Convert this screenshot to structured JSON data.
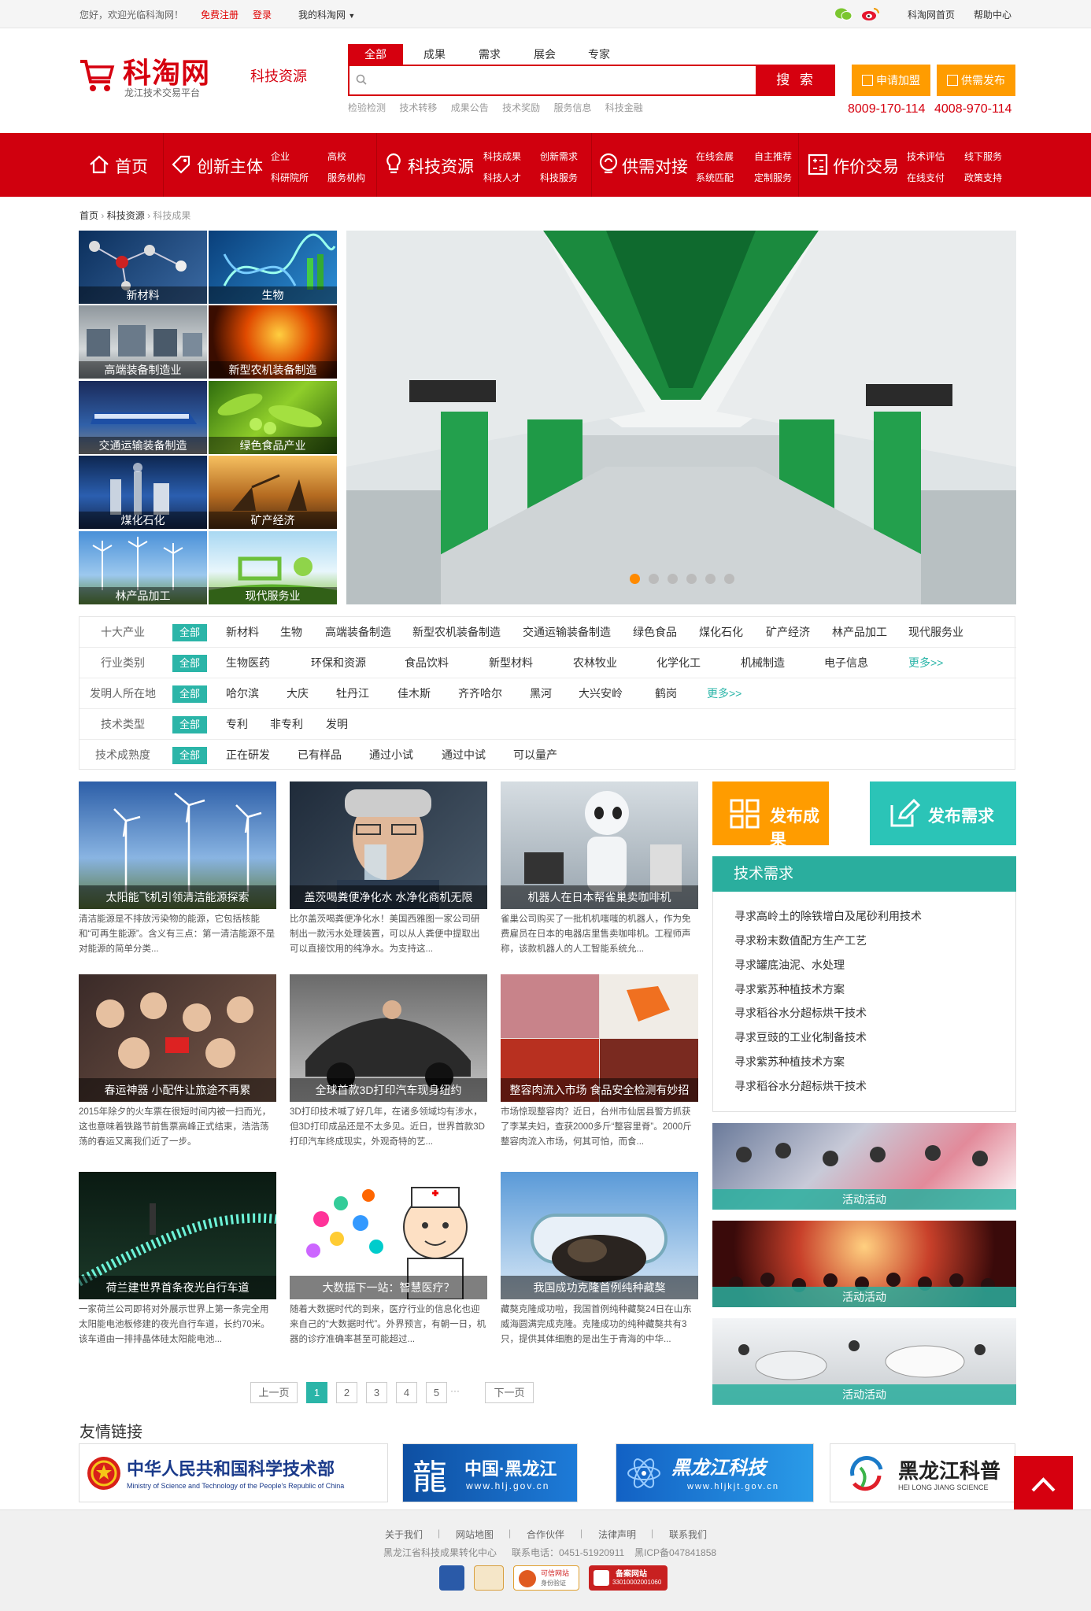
{
  "topbar": {
    "welcome": "您好，欢迎光临科淘网！",
    "register": "免费注册",
    "login": "登录",
    "my": "我的科淘网",
    "home": "科淘网首页",
    "help": "帮助中心"
  },
  "header": {
    "logo": "科淘网",
    "logo_sub": "龙江技术交易平台",
    "section": "科技资源",
    "search_tabs": [
      "全部",
      "成果",
      "需求",
      "展会",
      "专家"
    ],
    "search_button": "搜 索",
    "hot_words": [
      "检验检测",
      "技术转移",
      "成果公告",
      "技术奖励",
      "服务信息",
      "科技金融"
    ],
    "join_button": "申请加盟",
    "publish_button": "供需发布",
    "phone1": "8009-170-114",
    "phone2": "4008-970-114"
  },
  "nav": {
    "home": "首页",
    "main_body": "创新主体",
    "main_body_sub": [
      "企业",
      "高校",
      "科研院所",
      "服务机构"
    ],
    "resources": "科技资源",
    "resources_sub": [
      "科技成果",
      "创新需求",
      "科技人才",
      "科技服务"
    ],
    "supply": "供需对接",
    "supply_sub": [
      "在线会展",
      "自主推荐",
      "系统匹配",
      "定制服务"
    ],
    "trade": "作价交易",
    "trade_sub": [
      "技术评估",
      "线下服务",
      "在线支付",
      "政策支持"
    ]
  },
  "breadcrumb": [
    "首页",
    "科技资源",
    "科技成果"
  ],
  "categories": [
    "新材料",
    "生物",
    "高端装备制造业",
    "新型农机装备制造",
    "交通运输装备制造",
    "绿色食品产业",
    "煤化石化",
    "矿产经济",
    "林产品加工",
    "现代服务业"
  ],
  "banner": {
    "slide_count": 6,
    "active": 1
  },
  "filters": {
    "all": "全部",
    "more": "更多>>",
    "rows": [
      {
        "label": "十大产业",
        "items": [
          "新材料",
          "生物",
          "高端装备制造",
          "新型农机装备制造",
          "交通运输装备制造",
          "绿色食品",
          "煤化石化",
          "矿产经济",
          "林产品加工",
          "现代服务业"
        ]
      },
      {
        "label": "行业类别",
        "items": [
          "生物医药",
          "环保和资源",
          "食品饮料",
          "新型材料",
          "农林牧业",
          "化学化工",
          "机械制造",
          "电子信息"
        ]
      },
      {
        "label": "发明人所在地",
        "items": [
          "哈尔滨",
          "大庆",
          "牡丹江",
          "佳木斯",
          "齐齐哈尔",
          "黑河",
          "大兴安岭",
          "鹤岗"
        ]
      },
      {
        "label": "技术类型",
        "items": [
          "专利",
          "非专利",
          "发明"
        ]
      },
      {
        "label": "技术成熟度",
        "items": [
          "正在研发",
          "已有样品",
          "通过小试",
          "通过中试",
          "可以量产"
        ]
      }
    ]
  },
  "news": [
    {
      "title": "太阳能飞机引领清洁能源探索",
      "desc": "清洁能源是不排放污染物的能源，它包括核能和“可再生能源”。含义有三点：第一清洁能源不是对能源的简单分类..."
    },
    {
      "title": "盖茨喝粪便净化水 水净化商机无限",
      "desc": "比尔盖茨喝粪便净化水！美国西雅图一家公司研制出一款污水处理装置，可以从人粪便中提取出可以直接饮用的纯净水。为支持这..."
    },
    {
      "title": "机器人在日本帮雀巢卖咖啡机",
      "desc": "雀巢公司购买了一批机机嗤嗤的机器人，作为免费雇员在日本的电器店里售卖咖啡机。工程师声称，该款机器人的人工智能系统允..."
    },
    {
      "title": "春运神器 小配件让旅途不再累",
      "desc": "2015年除夕的火车票在很短时间内被一扫而光，这也意味着铁路节前售票高峰正式结束，浩浩荡荡的春运又离我们近了一步。"
    },
    {
      "title": "全球首款3D打印汽车现身纽约",
      "desc": "3D打印技术喊了好几年，在诸多领域均有涉水，但3D打印成品还是不太多见。近日，世界首款3D打印汽车终成现实，外观奇特的艺..."
    },
    {
      "title": "整容肉流入市场 食品安全检测有妙招",
      "desc": "市场惊现整容肉？近日，台州市仙居县警方抓获了李某夫妇，查获2000多斤“整容里脊”。2000斤整容肉流入市场，何其可怕，而食..."
    },
    {
      "title": "荷兰建世界首条夜光自行车道",
      "desc": "一家荷兰公司即将对外展示世界上第一条完全用太阳能电池板修建的夜光自行车道，长约70米。该车道由一排排晶体硅太阳能电池..."
    },
    {
      "title": "大数据下一站：智慧医疗？",
      "desc": "随着大数据时代的到来，医疗行业的信息化也迎来自己的“大数据时代”。外界预言，有朝一日，机器的诊疗准确率甚至可能超过..."
    },
    {
      "title": "我国成功克隆首例纯种藏獒",
      "desc": "藏獒克隆成功啦，我国首例纯种藏獒24日在山东威海圆满完成克隆。克隆成功的纯种藏獒共有3只，提供其体细胞的是出生于青海的中华..."
    }
  ],
  "right": {
    "publish_result": "发布成果",
    "publish_demand": "发布需求",
    "demand_title": "技术需求",
    "demands": [
      "寻求高岭土的除铁增白及尾砂利用技术",
      "寻求粉末数值配方生产工艺",
      "寻求罐底油泥、水处理",
      "寻求紫苏种植技术方案",
      "寻求稻谷水分超标烘干技术",
      "寻求豆豉的工业化制备技术",
      "寻求紫苏种植技术方案",
      "寻求稻谷水分超标烘干技术"
    ],
    "activities": [
      "活动活动",
      "活动活动",
      "活动活动"
    ]
  },
  "pager": {
    "prev": "上一页",
    "pages": [
      "1",
      "2",
      "3",
      "4",
      "5"
    ],
    "ellipsis": "···",
    "next": "下一页",
    "current": "1"
  },
  "links": {
    "title": "友情链接",
    "most": "中华人民共和国科学技术部",
    "most_en": "Ministry of Science and Technology of the People's Republic of China",
    "hlj": "中国·黑龙江",
    "hlj_url": "www.hlj.gov.cn",
    "hljkjt": "黑龙江科技",
    "hljkjt_url": "www.hljkjt.gov.cn",
    "kepu": "黑龙江科普",
    "kepu_en": "HEI LONG JIANG SCIENCE"
  },
  "footer": {
    "links": [
      "关于我们",
      "网站地图",
      "合作伙伴",
      "法律声明",
      "联系我们"
    ],
    "center": "黑龙江省科技成果转化中心",
    "phone": "联系电话：0451-51920911",
    "icp": "黑ICP备047841858",
    "badge1": "可信网站",
    "badge1_sub": "身份验证",
    "badge2": "备案网站",
    "badge2_sub": "33010002001060"
  },
  "colors": {
    "brand_red": "#d0000e",
    "teal": "#2bb5a8",
    "orange": "#ff9c00"
  }
}
